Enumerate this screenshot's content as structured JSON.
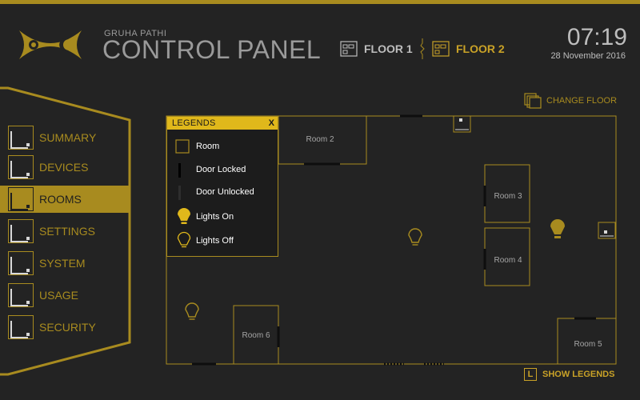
{
  "app": {
    "brand_subtitle": "GRUHA PATHI",
    "brand_title": "CONTROL PANEL",
    "time": "07:19",
    "date": "28 November 2016"
  },
  "floors": {
    "floor1_label": "FLOOR 1",
    "floor2_label": "FLOOR 2",
    "selected": "FLOOR 2"
  },
  "sidebar": {
    "items": [
      {
        "label": "SUMMARY",
        "icon": "room-icon"
      },
      {
        "label": "DEVICES",
        "icon": "room-icon"
      },
      {
        "label": "ROOMS",
        "icon": "room-icon",
        "active": true
      },
      {
        "label": "SETTINGS",
        "icon": "room-icon"
      },
      {
        "label": "SYSTEM",
        "icon": "room-icon"
      },
      {
        "label": "USAGE",
        "icon": "room-icon"
      },
      {
        "label": "SECURITY",
        "icon": "room-icon"
      }
    ]
  },
  "actions": {
    "change_floor": "CHANGE FLOOR",
    "show_legends": "SHOW LEGENDS",
    "show_legends_key": "L"
  },
  "legend": {
    "title": "LEGENDS",
    "close": "X",
    "items": [
      {
        "label": "Room",
        "icon": "room-square-icon"
      },
      {
        "label": "Door Locked",
        "icon": "door-locked-icon"
      },
      {
        "label": "Door Unlocked",
        "icon": "door-unlocked-icon"
      },
      {
        "label": "Lights On",
        "icon": "bulb-on-icon"
      },
      {
        "label": "Lights Off",
        "icon": "bulb-off-icon"
      }
    ]
  },
  "rooms": {
    "room2": "Room 2",
    "room3": "Room 3",
    "room4": "Room 4",
    "room5": "Room 5",
    "room6": "Room 6"
  },
  "colors": {
    "accent": "#a88b1f",
    "accent_bright": "#e0b81b",
    "background": "#232323",
    "text_muted": "#9a9a9a"
  }
}
